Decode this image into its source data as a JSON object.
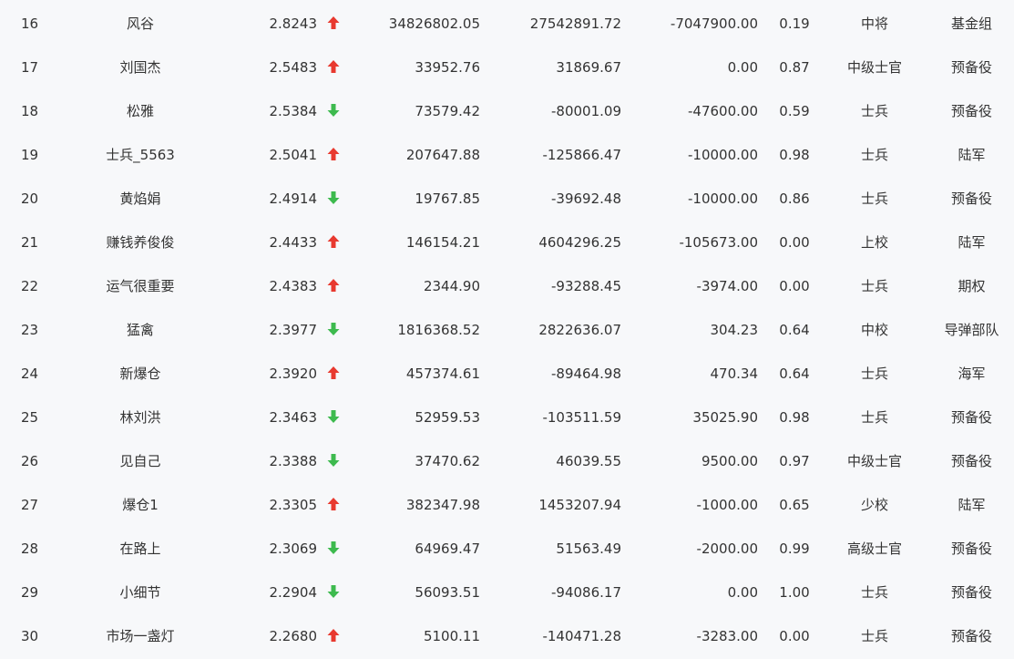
{
  "colors": {
    "up": "#e8392f",
    "down": "#3dba4e",
    "text": "#333333",
    "background": "#f7f8fa"
  },
  "rows": [
    {
      "rank": "16",
      "name": "风谷",
      "score": "2.8243",
      "trend": "up",
      "trend_icon": "arrow-up-icon",
      "v1": "34826802.05",
      "v2": "27542891.72",
      "v3": "-7047900.00",
      "ratio": "0.19",
      "level": "中将",
      "group": "基金组"
    },
    {
      "rank": "17",
      "name": "刘国杰",
      "score": "2.5483",
      "trend": "up",
      "trend_icon": "arrow-up-icon",
      "v1": "33952.76",
      "v2": "31869.67",
      "v3": "0.00",
      "ratio": "0.87",
      "level": "中级士官",
      "group": "预备役"
    },
    {
      "rank": "18",
      "name": "松雅",
      "score": "2.5384",
      "trend": "down",
      "trend_icon": "arrow-down-icon",
      "v1": "73579.42",
      "v2": "-80001.09",
      "v3": "-47600.00",
      "ratio": "0.59",
      "level": "士兵",
      "group": "预备役"
    },
    {
      "rank": "19",
      "name": "士兵_5563",
      "score": "2.5041",
      "trend": "up",
      "trend_icon": "arrow-up-icon",
      "v1": "207647.88",
      "v2": "-125866.47",
      "v3": "-10000.00",
      "ratio": "0.98",
      "level": "士兵",
      "group": "陆军"
    },
    {
      "rank": "20",
      "name": "黄焰娟",
      "score": "2.4914",
      "trend": "down",
      "trend_icon": "arrow-down-icon",
      "v1": "19767.85",
      "v2": "-39692.48",
      "v3": "-10000.00",
      "ratio": "0.86",
      "level": "士兵",
      "group": "预备役"
    },
    {
      "rank": "21",
      "name": "赚钱养俊俊",
      "score": "2.4433",
      "trend": "up",
      "trend_icon": "arrow-up-icon",
      "v1": "146154.21",
      "v2": "4604296.25",
      "v3": "-105673.00",
      "ratio": "0.00",
      "level": "上校",
      "group": "陆军"
    },
    {
      "rank": "22",
      "name": "运气很重要",
      "score": "2.4383",
      "trend": "up",
      "trend_icon": "arrow-up-icon",
      "v1": "2344.90",
      "v2": "-93288.45",
      "v3": "-3974.00",
      "ratio": "0.00",
      "level": "士兵",
      "group": "期权"
    },
    {
      "rank": "23",
      "name": "猛禽",
      "score": "2.3977",
      "trend": "down",
      "trend_icon": "arrow-down-icon",
      "v1": "1816368.52",
      "v2": "2822636.07",
      "v3": "304.23",
      "ratio": "0.64",
      "level": "中校",
      "group": "导弹部队"
    },
    {
      "rank": "24",
      "name": "新爆仓",
      "score": "2.3920",
      "trend": "up",
      "trend_icon": "arrow-up-icon",
      "v1": "457374.61",
      "v2": "-89464.98",
      "v3": "470.34",
      "ratio": "0.64",
      "level": "士兵",
      "group": "海军"
    },
    {
      "rank": "25",
      "name": "林刘洪",
      "score": "2.3463",
      "trend": "down",
      "trend_icon": "arrow-down-icon",
      "v1": "52959.53",
      "v2": "-103511.59",
      "v3": "35025.90",
      "ratio": "0.98",
      "level": "士兵",
      "group": "预备役"
    },
    {
      "rank": "26",
      "name": "见自己",
      "score": "2.3388",
      "trend": "down",
      "trend_icon": "arrow-down-icon",
      "v1": "37470.62",
      "v2": "46039.55",
      "v3": "9500.00",
      "ratio": "0.97",
      "level": "中级士官",
      "group": "预备役"
    },
    {
      "rank": "27",
      "name": "爆仓1",
      "score": "2.3305",
      "trend": "up",
      "trend_icon": "arrow-up-icon",
      "v1": "382347.98",
      "v2": "1453207.94",
      "v3": "-1000.00",
      "ratio": "0.65",
      "level": "少校",
      "group": "陆军"
    },
    {
      "rank": "28",
      "name": "在路上",
      "score": "2.3069",
      "trend": "down",
      "trend_icon": "arrow-down-icon",
      "v1": "64969.47",
      "v2": "51563.49",
      "v3": "-2000.00",
      "ratio": "0.99",
      "level": "高级士官",
      "group": "预备役"
    },
    {
      "rank": "29",
      "name": "小细节",
      "score": "2.2904",
      "trend": "down",
      "trend_icon": "arrow-down-icon",
      "v1": "56093.51",
      "v2": "-94086.17",
      "v3": "0.00",
      "ratio": "1.00",
      "level": "士兵",
      "group": "预备役"
    },
    {
      "rank": "30",
      "name": "市场一盏灯",
      "score": "2.2680",
      "trend": "up",
      "trend_icon": "arrow-up-icon",
      "v1": "5100.11",
      "v2": "-140471.28",
      "v3": "-3283.00",
      "ratio": "0.00",
      "level": "士兵",
      "group": "预备役"
    }
  ]
}
